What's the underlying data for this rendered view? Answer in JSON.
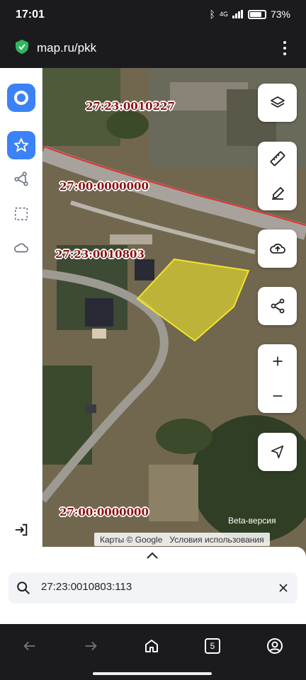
{
  "status_bar": {
    "time": "17:01",
    "network": "4G",
    "battery_percent": "73%"
  },
  "browser": {
    "url": "map.ru/pkk",
    "tab_count": "5"
  },
  "map": {
    "parcel_labels": [
      "27:23:0010227",
      "27:00:0000000",
      "27:23:0010803",
      "27:00:0000000"
    ],
    "beta_label": "Beta-версия",
    "attribution": "Карты © Google",
    "terms_link": "Условия использования",
    "selected_parcel_color": "#f0e62a"
  },
  "search": {
    "value": "27:23:0010803:113"
  },
  "colors": {
    "accent": "#3b82f6",
    "label_text": "#8b1010",
    "road_line": "#e03030"
  },
  "icons": {
    "sidebar": [
      "favorites-star-icon",
      "route-nodes-icon",
      "selection-area-icon",
      "cloud-icon",
      "logout-icon"
    ],
    "controls": [
      "layers-icon",
      "ruler-icon",
      "edit-icon",
      "upload-icon",
      "share-icon",
      "zoom-in-icon",
      "zoom-out-icon",
      "locate-icon"
    ]
  }
}
